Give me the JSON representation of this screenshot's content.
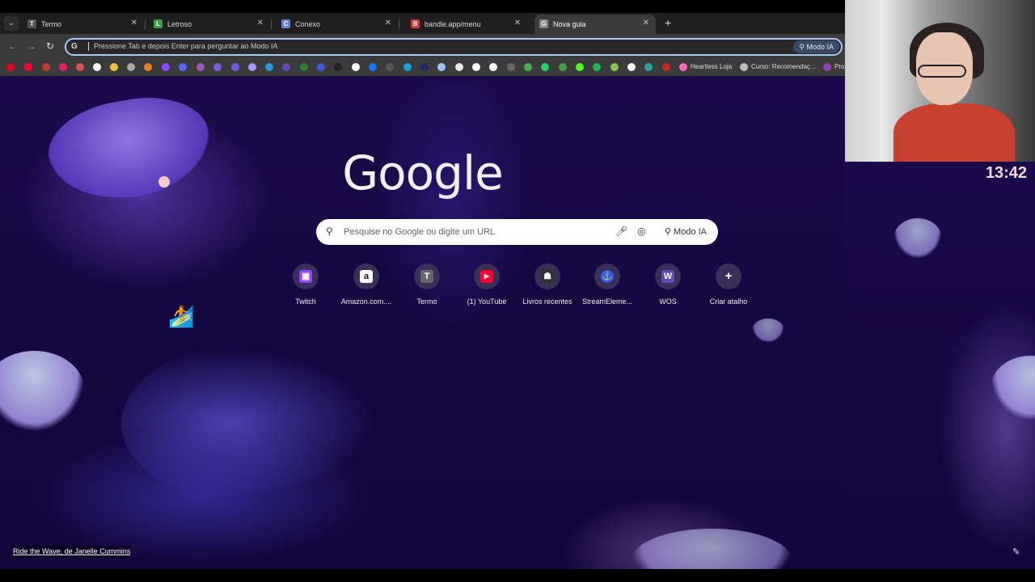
{
  "tabs": [
    {
      "title": "Termo",
      "favicon": "T",
      "favicon_color": "#555555"
    },
    {
      "title": "Letroso",
      "favicon": "L",
      "favicon_color": "#3c9b4a"
    },
    {
      "title": "Conexo",
      "favicon": "C",
      "favicon_color": "#6b7fd0"
    },
    {
      "title": "bandle.app/menu",
      "favicon": "B",
      "favicon_color": "#d33b3b"
    },
    {
      "title": "Nova guia",
      "favicon": "G",
      "favicon_color": "#888888",
      "active": true
    }
  ],
  "omnibox": {
    "placeholder": "Pressione Tab e depois Enter para perguntar ao Modo IA",
    "modo_label": "Modo IA"
  },
  "bookmarks": {
    "labels": [
      "Heartless Loja",
      "Curso: Recomendaç...",
      "Pro"
    ]
  },
  "ntp": {
    "logo": "Google",
    "search_placeholder": "Pesquise no Google ou digite um URL",
    "modo_label": "Modo IA",
    "shortcuts": [
      {
        "label": "Twitch",
        "icon": "twitch-icon",
        "glyph": "▣",
        "color": "#9146ff"
      },
      {
        "label": "Amazon.com....",
        "icon": "amazon-icon",
        "glyph": "a",
        "color": "#ffffff"
      },
      {
        "label": "Termo",
        "icon": "termo-icon",
        "glyph": "T",
        "color": "#666666"
      },
      {
        "label": "(1) YouTube",
        "icon": "youtube-icon",
        "glyph": "▶",
        "color": "#ff0033"
      },
      {
        "label": "Livros recentes",
        "icon": "livros-icon",
        "glyph": "☗",
        "color": "#333333"
      },
      {
        "label": "StreamEleme...",
        "icon": "streamelements-icon",
        "glyph": "⚓",
        "color": "#3b5bd6"
      },
      {
        "label": "WOS",
        "icon": "wos-icon",
        "glyph": "W",
        "color": "#5d4bb4"
      },
      {
        "label": "Criar atalho",
        "icon": "plus-icon",
        "glyph": "+",
        "color": "#3a2f58"
      }
    ],
    "credit": "Ride the Wave, de Janelle Cummins"
  },
  "overlay": {
    "clock": "13:42"
  }
}
